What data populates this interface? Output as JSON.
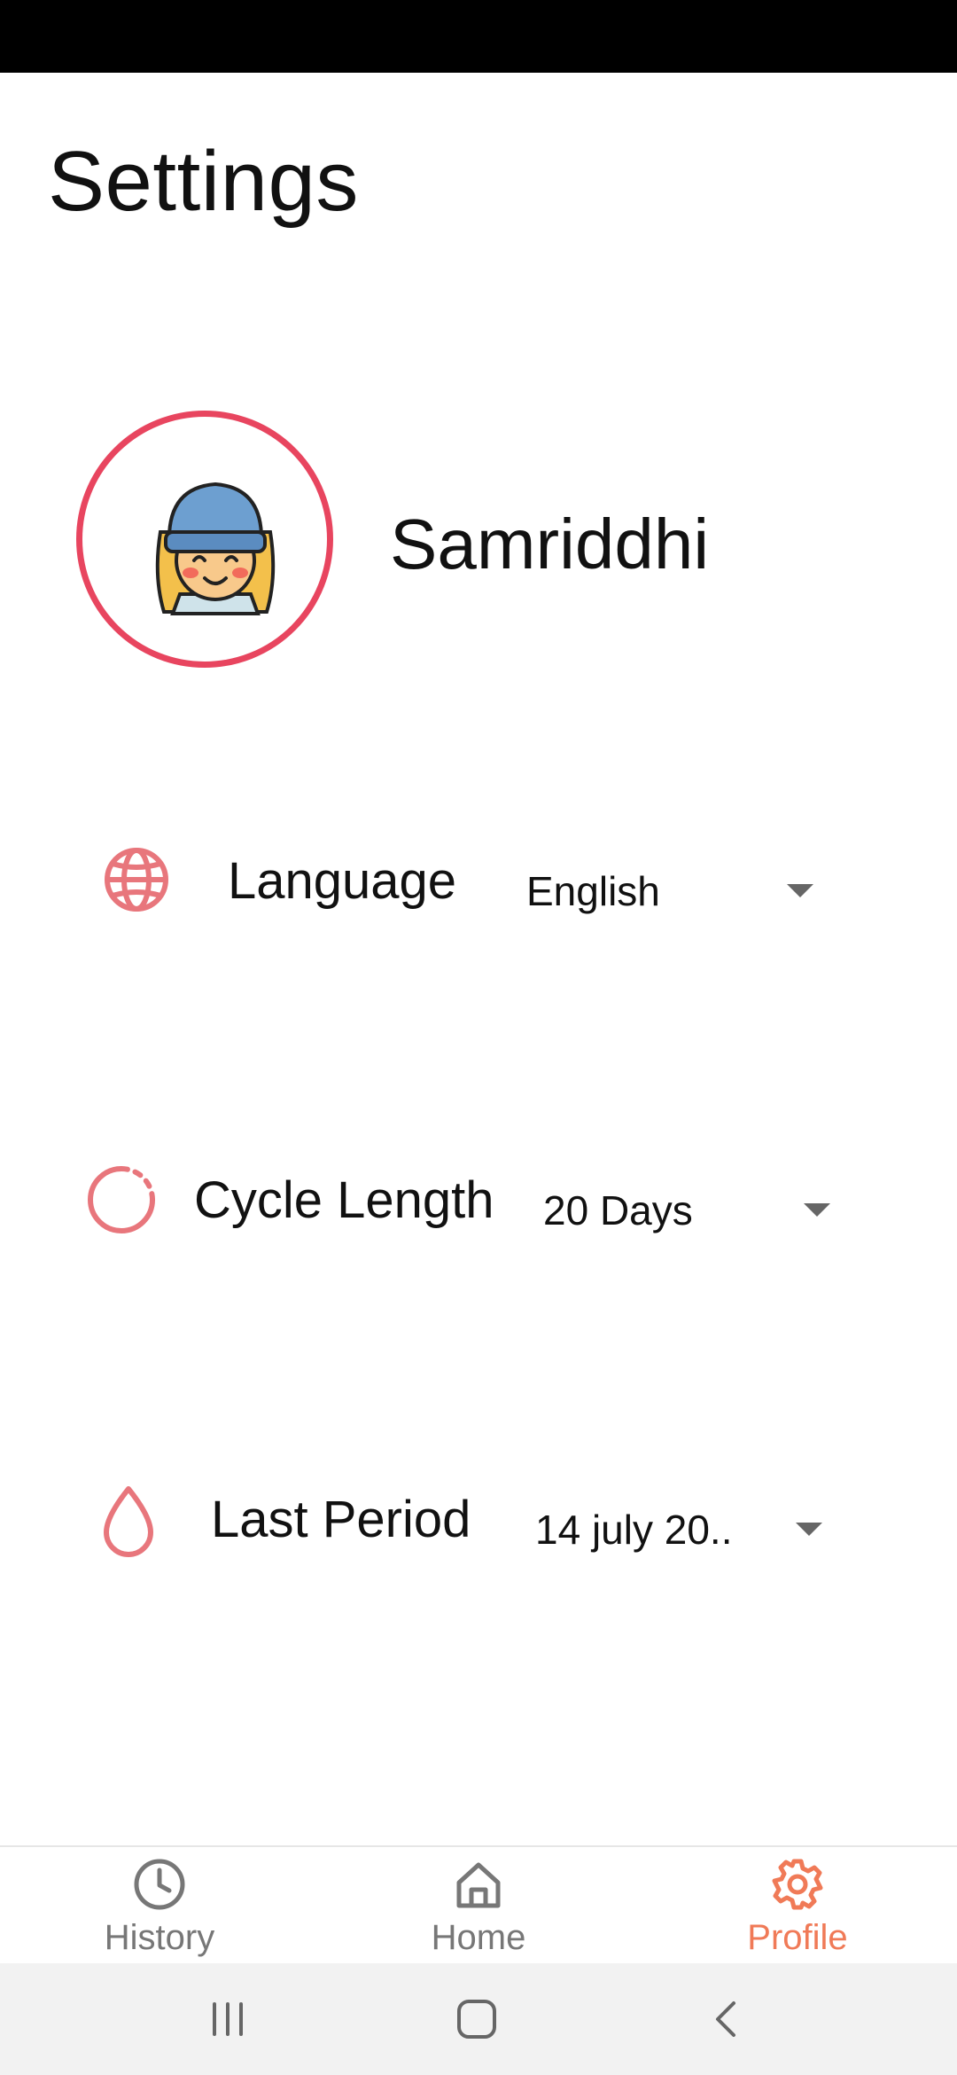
{
  "page": {
    "title": "Settings"
  },
  "profile": {
    "name": "Samriddhi",
    "ring_color": "#e8455f"
  },
  "settings": [
    {
      "icon": "globe-icon",
      "label": "Language",
      "value": "English"
    },
    {
      "icon": "cycle-icon",
      "label": "Cycle Length",
      "value": "20 Days"
    },
    {
      "icon": "drop-icon",
      "label": "Last Period",
      "value": "14 july 20.."
    }
  ],
  "bottom_nav": {
    "items": [
      {
        "icon": "clock-icon",
        "label": "History",
        "active": false
      },
      {
        "icon": "home-icon",
        "label": "Home",
        "active": false
      },
      {
        "icon": "gear-icon",
        "label": "Profile",
        "active": true
      }
    ],
    "active_color": "#f07a57",
    "inactive_color": "#777777"
  },
  "colors": {
    "accent_pink": "#e8767c",
    "status_bar": "#000000"
  }
}
